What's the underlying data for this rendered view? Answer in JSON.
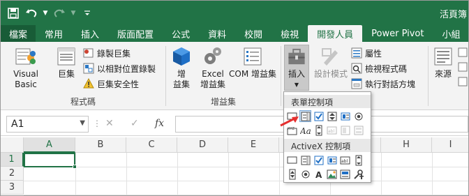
{
  "title_bar": {
    "title": "活頁簿"
  },
  "tabs": [
    "檔案",
    "常用",
    "插入",
    "版面配置",
    "公式",
    "資料",
    "校閱",
    "檢視",
    "開發人員",
    "Power Pivot",
    "小組"
  ],
  "active_tab_index": 8,
  "ribbon": {
    "code_group": {
      "label": "程式碼",
      "visual_basic": "Visual Basic",
      "macros": "巨集",
      "record_macro": "錄製巨集",
      "relative_refs": "以相對位置錄製",
      "macro_security": "巨集安全性"
    },
    "addins_group": {
      "label": "增益集",
      "addins_line1": "增",
      "addins_line2": "益集",
      "excel_addins_line1": "Excel",
      "excel_addins_line2": "增益集",
      "com_addins": "COM 增益集"
    },
    "controls_group": {
      "insert": "插入",
      "design_mode": "設計模式",
      "properties": "屬性",
      "view_code": "檢視程式碼",
      "run_dialog": "執行對話方塊"
    },
    "xml_group": {
      "source": "來源"
    }
  },
  "formula_bar": {
    "name_box": "A1",
    "cancel": "✕",
    "enter": "✓",
    "fx": "fx"
  },
  "grid": {
    "columns": [
      "A",
      "B",
      "C",
      "D",
      "E",
      "F",
      "G",
      "H",
      "I"
    ],
    "rows": [
      "1",
      "2",
      "3"
    ],
    "active_cell": "A1"
  },
  "popup": {
    "form_controls_label": "表單控制項",
    "activex_label": "ActiveX 控制項"
  },
  "colors": {
    "accent": "#217346",
    "file_tab": "#185c37",
    "ribbon_bg": "#f3f3f3"
  }
}
